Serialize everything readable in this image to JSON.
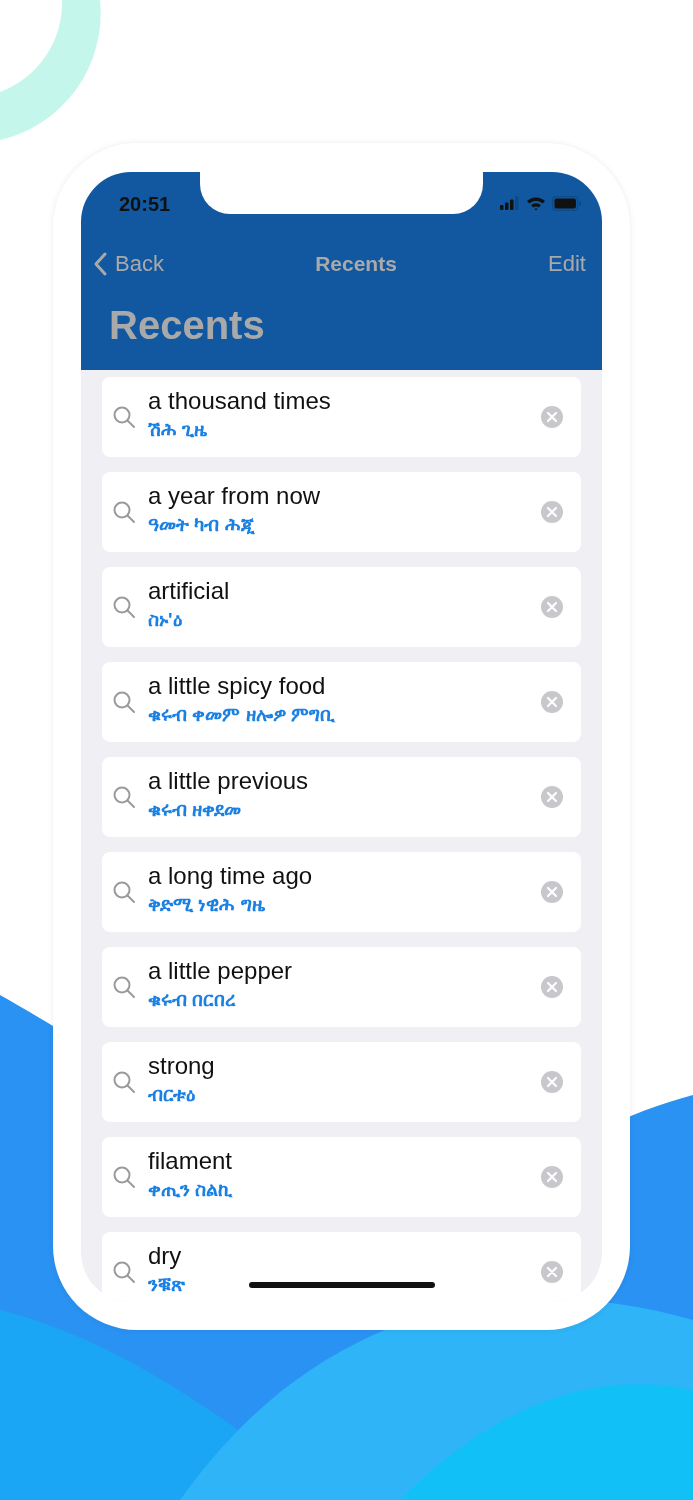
{
  "status_bar": {
    "time": "20:51"
  },
  "nav_bar": {
    "back": "Back",
    "title": "Recents",
    "edit": "Edit"
  },
  "large_title": "Recents",
  "recents": [
    {
      "english": "a thousand times",
      "tigrinya": "ሽሕ ጊዜ"
    },
    {
      "english": "a year from now",
      "tigrinya": "ዓመት ካብ ሕጂ"
    },
    {
      "english": "artificial",
      "tigrinya": "ስኑ'ዕ"
    },
    {
      "english": "a little spicy food",
      "tigrinya": "ቁሩብ ቀመም ዘሎዎ ምግቢ"
    },
    {
      "english": "a little previous",
      "tigrinya": "ቁሩብ ዘቀደመ"
    },
    {
      "english": "a long time ago",
      "tigrinya": "ቅድሚ ነዊሕ ግዜ"
    },
    {
      "english": "a little pepper",
      "tigrinya": "ቁሩብ በርበረ"
    },
    {
      "english": "strong",
      "tigrinya": "ብርቱዕ"
    },
    {
      "english": "filament",
      "tigrinya": "ቀጢን ስልኪ"
    },
    {
      "english": "dry",
      "tigrinya": "ንቑጽ"
    }
  ]
}
